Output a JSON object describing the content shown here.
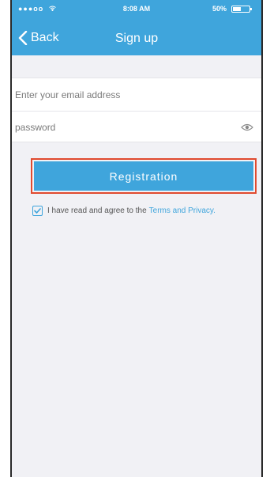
{
  "status_bar": {
    "signal": "●●●oo",
    "time": "8:08 AM",
    "battery_percent": "50%",
    "battery_level": 0.5
  },
  "nav": {
    "back_label": "Back",
    "title": "Sign up",
    "color": "#3fa5dc"
  },
  "form": {
    "email_placeholder": "Enter your email address",
    "email_value": "",
    "password_placeholder": "password",
    "password_value": ""
  },
  "actions": {
    "register_label": "Registration",
    "highlight_color": "#e04a2f"
  },
  "agreement": {
    "checked": true,
    "text": "I have read and agree to the",
    "link_text": "Terms and Privacy."
  }
}
